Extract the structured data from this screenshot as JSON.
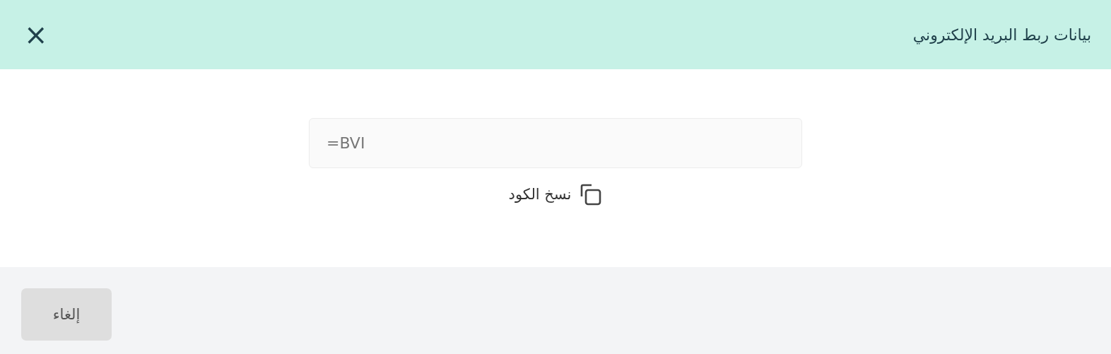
{
  "dialog": {
    "title": "بيانات ربط البريد الإلكتروني",
    "close": "×"
  },
  "code_field": {
    "value": "=BVI"
  },
  "copy_action": {
    "label": "نسخ الكود"
  },
  "footer": {
    "buttons": [
      "إلغاء"
    ]
  }
}
